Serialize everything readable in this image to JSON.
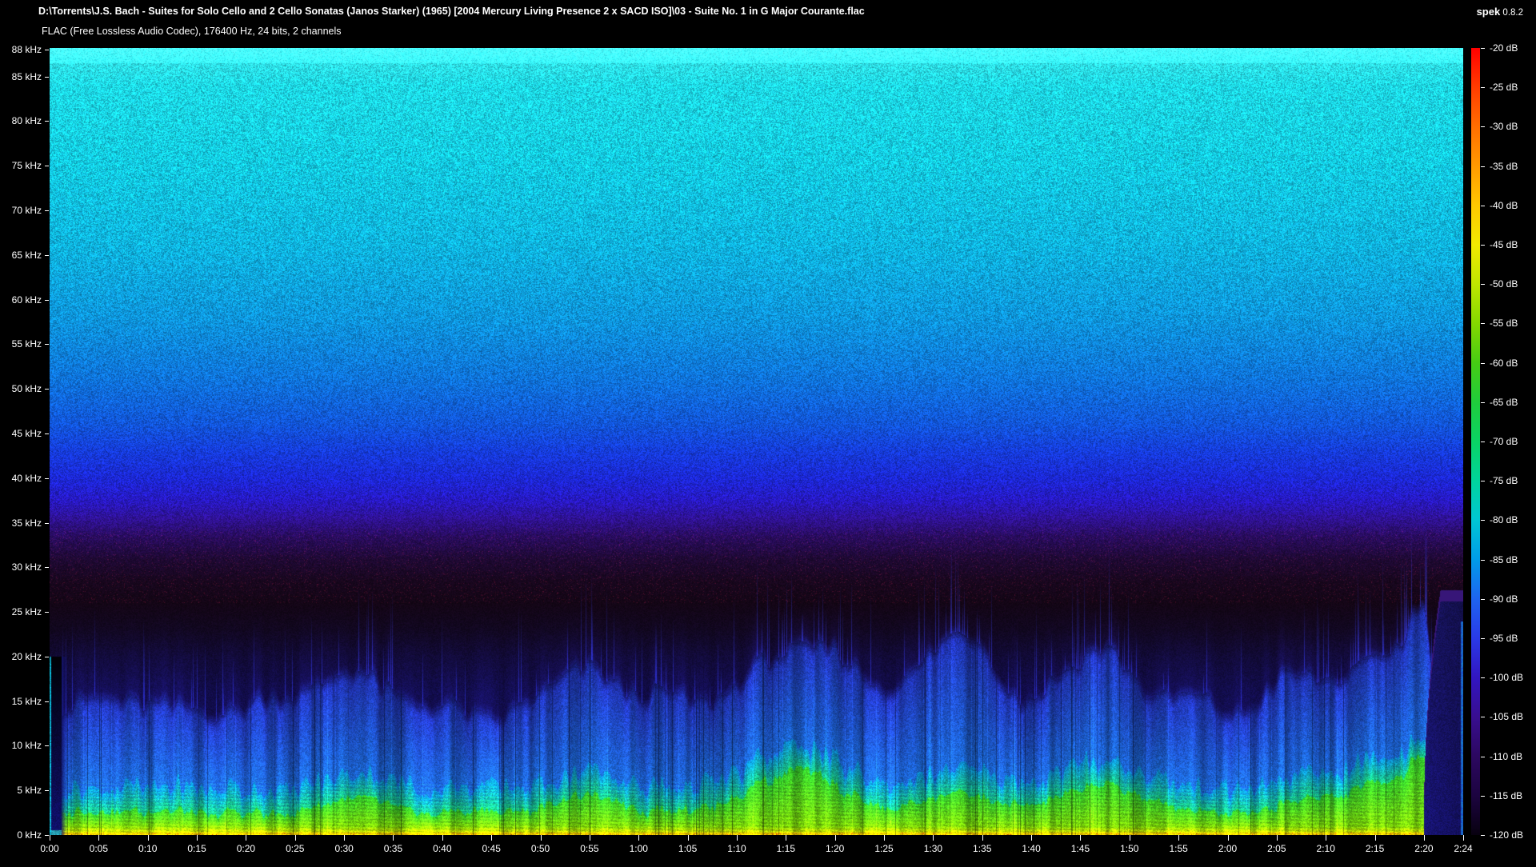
{
  "header": {
    "file_path": "D:\\Torrents\\J.S. Bach - Suites for Solo Cello and 2 Cello Sonatas (Janos Starker) (1965) [2004 Mercury Living Presence 2 x SACD ISO]\\03 - Suite No. 1 in G Major Courante.flac",
    "app_name": "spek",
    "app_version": "0.8.2",
    "file_info": "FLAC (Free Lossless Audio Codec), 176400 Hz, 24 bits, 2 channels"
  },
  "chart_data": {
    "type": "heatmap",
    "subtype": "audio-spectrogram",
    "x_axis": {
      "label": "time",
      "range_seconds": [
        0,
        144
      ],
      "ticks": [
        {
          "sec": 0,
          "label": "0:00"
        },
        {
          "sec": 5,
          "label": "0:05"
        },
        {
          "sec": 10,
          "label": "0:10"
        },
        {
          "sec": 15,
          "label": "0:15"
        },
        {
          "sec": 20,
          "label": "0:20"
        },
        {
          "sec": 25,
          "label": "0:25"
        },
        {
          "sec": 30,
          "label": "0:30"
        },
        {
          "sec": 35,
          "label": "0:35"
        },
        {
          "sec": 40,
          "label": "0:40"
        },
        {
          "sec": 45,
          "label": "0:45"
        },
        {
          "sec": 50,
          "label": "0:50"
        },
        {
          "sec": 55,
          "label": "0:55"
        },
        {
          "sec": 60,
          "label": "1:00"
        },
        {
          "sec": 65,
          "label": "1:05"
        },
        {
          "sec": 70,
          "label": "1:10"
        },
        {
          "sec": 75,
          "label": "1:15"
        },
        {
          "sec": 80,
          "label": "1:20"
        },
        {
          "sec": 85,
          "label": "1:25"
        },
        {
          "sec": 90,
          "label": "1:30"
        },
        {
          "sec": 95,
          "label": "1:35"
        },
        {
          "sec": 100,
          "label": "1:40"
        },
        {
          "sec": 105,
          "label": "1:45"
        },
        {
          "sec": 110,
          "label": "1:50"
        },
        {
          "sec": 115,
          "label": "1:55"
        },
        {
          "sec": 120,
          "label": "2:00"
        },
        {
          "sec": 125,
          "label": "2:05"
        },
        {
          "sec": 130,
          "label": "2:10"
        },
        {
          "sec": 135,
          "label": "2:15"
        },
        {
          "sec": 140,
          "label": "2:20"
        },
        {
          "sec": 144,
          "label": "2:24"
        }
      ]
    },
    "y_axis": {
      "label": "frequency",
      "range_khz": [
        0,
        88.2
      ],
      "ticks": [
        {
          "khz": 88,
          "label": "88 kHz"
        },
        {
          "khz": 85,
          "label": "85 kHz"
        },
        {
          "khz": 80,
          "label": "80 kHz"
        },
        {
          "khz": 75,
          "label": "75 kHz"
        },
        {
          "khz": 70,
          "label": "70 kHz"
        },
        {
          "khz": 65,
          "label": "65 kHz"
        },
        {
          "khz": 60,
          "label": "60 kHz"
        },
        {
          "khz": 55,
          "label": "55 kHz"
        },
        {
          "khz": 50,
          "label": "50 kHz"
        },
        {
          "khz": 45,
          "label": "45 kHz"
        },
        {
          "khz": 40,
          "label": "40 kHz"
        },
        {
          "khz": 35,
          "label": "35 kHz"
        },
        {
          "khz": 30,
          "label": "30 kHz"
        },
        {
          "khz": 25,
          "label": "25 kHz"
        },
        {
          "khz": 20,
          "label": "20 kHz"
        },
        {
          "khz": 15,
          "label": "15 kHz"
        },
        {
          "khz": 10,
          "label": "10 kHz"
        },
        {
          "khz": 5,
          "label": "5 kHz"
        },
        {
          "khz": 0,
          "label": "0 kHz"
        }
      ]
    },
    "legend": {
      "label": "level",
      "range_db": [
        -20,
        -120
      ],
      "ticks": [
        {
          "db": -20,
          "label": "-20 dB",
          "color": "#ff0000"
        },
        {
          "db": -25,
          "label": "-25 dB",
          "color": "#ff3c00"
        },
        {
          "db": -30,
          "label": "-30 dB",
          "color": "#ff6e00"
        },
        {
          "db": -35,
          "label": "-35 dB",
          "color": "#ff9a00"
        },
        {
          "db": -40,
          "label": "-40 dB",
          "color": "#ffc800"
        },
        {
          "db": -45,
          "label": "-45 dB",
          "color": "#f2ea00"
        },
        {
          "db": -50,
          "label": "-50 dB",
          "color": "#bfe600"
        },
        {
          "db": -55,
          "label": "-55 dB",
          "color": "#84d800"
        },
        {
          "db": -60,
          "label": "-60 dB",
          "color": "#46cc14"
        },
        {
          "db": -65,
          "label": "-65 dB",
          "color": "#20cc3c"
        },
        {
          "db": -70,
          "label": "-70 dB",
          "color": "#0ad464"
        },
        {
          "db": -75,
          "label": "-75 dB",
          "color": "#00d49c"
        },
        {
          "db": -80,
          "label": "-80 dB",
          "color": "#00c6d4"
        },
        {
          "db": -85,
          "label": "-85 dB",
          "color": "#009ce8"
        },
        {
          "db": -90,
          "label": "-90 dB",
          "color": "#1e64f0"
        },
        {
          "db": -95,
          "label": "-95 dB",
          "color": "#2a3ae8"
        },
        {
          "db": -100,
          "label": "-100 dB",
          "color": "#3216c2"
        },
        {
          "db": -105,
          "label": "-105 dB",
          "color": "#380e90"
        },
        {
          "db": -110,
          "label": "-110 dB",
          "color": "#2c0860"
        },
        {
          "db": -115,
          "label": "-115 dB",
          "color": "#1c0440"
        },
        {
          "db": -120,
          "label": "-120 dB",
          "color": "#080110"
        }
      ]
    },
    "content_summary": {
      "noise_floor_db_by_khz": [
        [
          88,
          -77
        ],
        [
          76,
          -79
        ],
        [
          66,
          -81
        ],
        [
          55,
          -85
        ],
        [
          46,
          -91
        ],
        [
          40,
          -97
        ],
        [
          36,
          -104
        ],
        [
          31,
          -114
        ],
        [
          27,
          -117
        ],
        [
          23,
          -112
        ],
        [
          20,
          -108
        ]
      ],
      "music_region": "vertical note streaks 0-20 kHz, occasional bursts to 26 kHz",
      "bottom_band": "strongest energy 0-3 kHz (green/yellow, -45 to -60 dB), orange-red flecks below 300 Hz",
      "silence": [
        {
          "from_sec": 0,
          "to_sec": 1.2,
          "desc": "intro silence, dark navy below 20 kHz"
        },
        {
          "from_sec": 140,
          "to_sec": 144,
          "desc": "fade-out, rounded dark navy blob below ~28 kHz"
        }
      ],
      "loud_passages": [
        {
          "t": 31,
          "width": 2.5,
          "env_boost_khz": 4,
          "green_boost_khz": 2
        },
        {
          "t": 55,
          "width": 3,
          "env_boost_khz": 4,
          "green_boost_khz": 2
        },
        {
          "t": 76,
          "width": 4.5,
          "env_boost_khz": 7,
          "green_boost_khz": 5
        },
        {
          "t": 93,
          "width": 3.5,
          "env_boost_khz": 7,
          "green_boost_khz": 2.5
        },
        {
          "t": 107,
          "width": 4,
          "env_boost_khz": 5,
          "green_boost_khz": 3.5
        },
        {
          "t": 130,
          "width": 3.5,
          "env_boost_khz": 4,
          "green_boost_khz": 2
        },
        {
          "t": 137,
          "width": 2.5,
          "env_boost_khz": 6,
          "green_boost_khz": 4
        },
        {
          "t": 139.6,
          "width": 0.9,
          "env_boost_khz": 8,
          "green_boost_khz": 5
        }
      ]
    }
  }
}
